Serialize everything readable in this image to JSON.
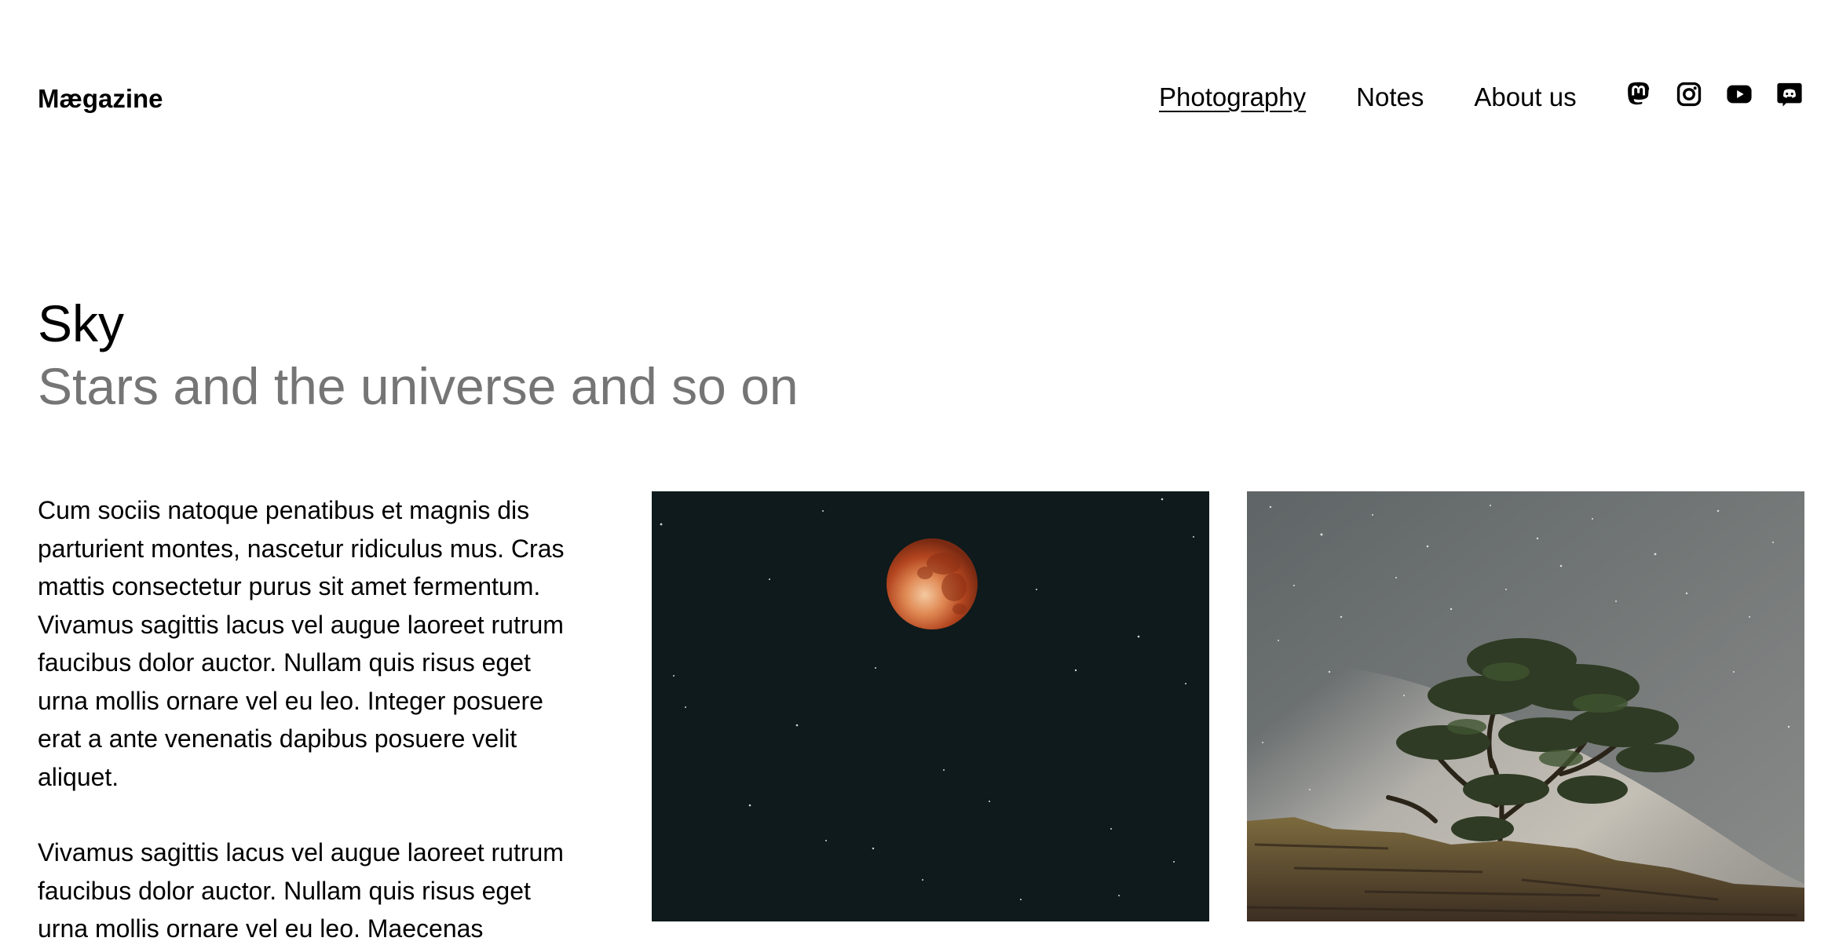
{
  "header": {
    "site_title": "Mægazine",
    "nav": [
      {
        "label": "Photography",
        "current": true
      },
      {
        "label": "Notes",
        "current": false
      },
      {
        "label": "About us",
        "current": false
      }
    ],
    "social_icons": [
      "mastodon-icon",
      "instagram-icon",
      "youtube-icon",
      "discord-icon"
    ]
  },
  "main": {
    "title": "Sky",
    "subtitle": "Stars and the universe and so on",
    "paragraphs": [
      "Cum sociis natoque penatibus et magnis dis parturient montes, nascetur ridiculus mus. Cras mattis consectetur purus sit amet fermentum. Vivamus sagittis lacus vel augue laoreet rutrum faucibus dolor auctor. Nullam quis risus eget urna mollis ornare vel eu leo. Integer posuere erat a ante venenatis dapibus posuere velit aliquet.",
      "Vivamus sagittis lacus vel augue laoreet rutrum faucibus dolor auctor. Nullam quis risus eget urna mollis ornare vel eu leo. Maecenas"
    ],
    "images": [
      {
        "name": "blood-moon-photo"
      },
      {
        "name": "milky-way-tree-photo"
      }
    ]
  },
  "colors": {
    "text": "#000000",
    "subtitle": "#757575",
    "background": "#ffffff",
    "moon_sky": "#0e1a1c"
  }
}
